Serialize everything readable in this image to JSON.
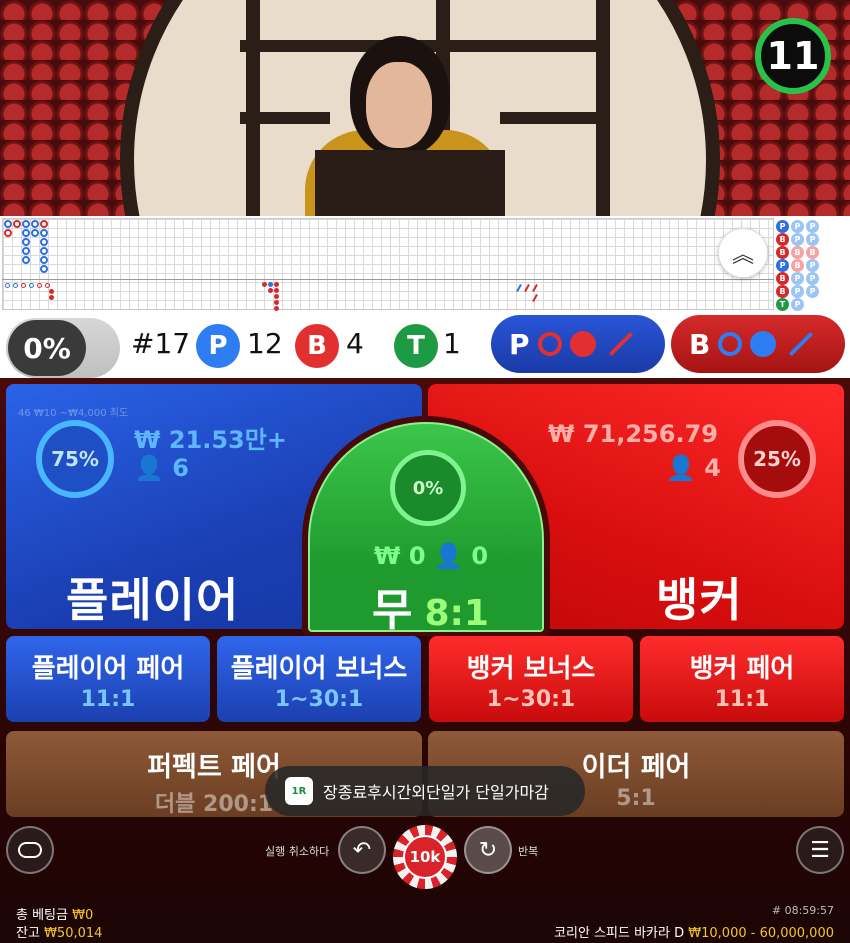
{
  "timer": "11",
  "roadmap": {
    "predict": [
      [
        "P",
        "P",
        "P"
      ],
      [
        "B",
        "P",
        "P"
      ],
      [
        "B",
        "B",
        "B"
      ],
      [
        "P",
        "B",
        "P"
      ],
      [
        "B",
        "P",
        "P"
      ],
      [
        "B",
        "P",
        "P"
      ],
      [
        "T",
        "P",
        ""
      ]
    ]
  },
  "stats": {
    "percent": "0%",
    "round": "#17",
    "player_letter": "P",
    "player_count": "12",
    "banker_letter": "B",
    "banker_count": "4",
    "tie_letter": "T",
    "tie_count": "1",
    "player_ask": "P",
    "banker_ask": "B"
  },
  "colors": {
    "player": "#2f6ee2",
    "banker": "#d62a2a",
    "tie": "#1e9a45",
    "gold": "#f3c626"
  },
  "player": {
    "limit": "46 ₩10 ~₩4,000 최도",
    "percent": "75%",
    "amount": "₩ 21.53만+",
    "players": "6",
    "label": "플레이어"
  },
  "banker": {
    "percent": "25%",
    "amount": "₩ 71,256.79",
    "players": "4",
    "label": "뱅커"
  },
  "tie": {
    "percent": "0%",
    "amount": "₩ 0",
    "players": "0",
    "label": "무",
    "odds": "8:1"
  },
  "side_bets": [
    {
      "label": "플레이어 페어",
      "odds": "11:1"
    },
    {
      "label": "플레이어 보너스",
      "odds": "1~30:1"
    },
    {
      "label": "뱅커 보너스",
      "odds": "1~30:1"
    },
    {
      "label": "뱅커 페어",
      "odds": "11:1"
    }
  ],
  "wide_bets": [
    {
      "label": "퍼펙트 페어",
      "odds": "더블 200:1"
    },
    {
      "label": "이더 페어",
      "odds": "5:1"
    }
  ],
  "toast": {
    "logo": "1R",
    "text": "장종료후시간외단일가 단일가마감"
  },
  "controls": {
    "undo_label": "실행 취소하다",
    "repeat_label": "반복",
    "chip": "10k"
  },
  "footer": {
    "total_bet_label": "총 베팅금",
    "total_bet_value": "₩0",
    "balance_label": "잔고",
    "balance_value": "₩50,014",
    "game_id": "# 08:59:57",
    "table_name": "코리안 스피드 바카라 D",
    "limits": "₩10,000 - 60,000,000"
  }
}
